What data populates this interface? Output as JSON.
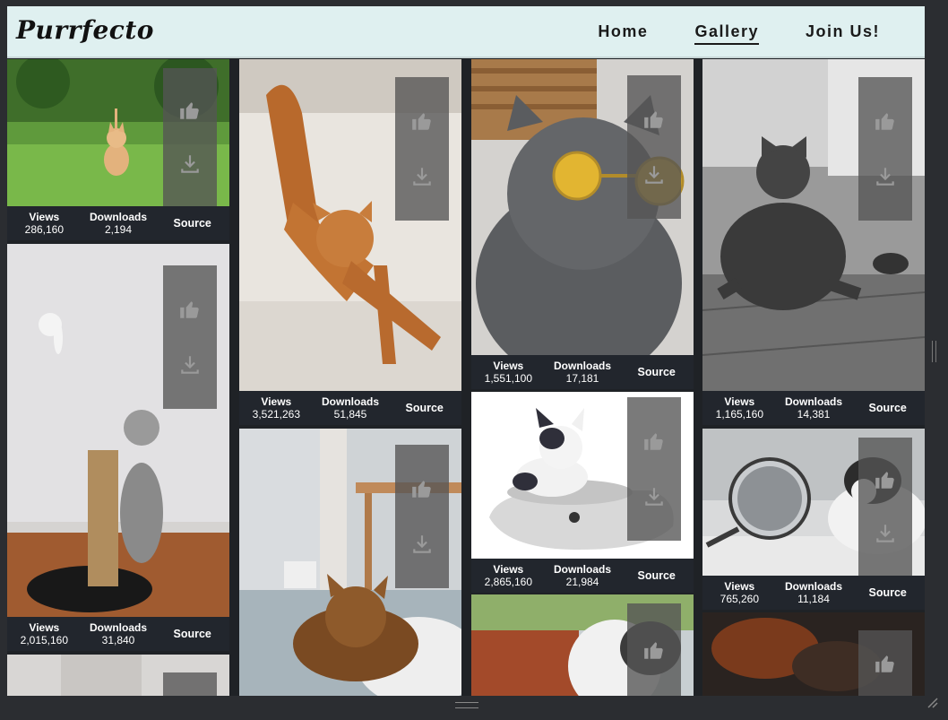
{
  "brand": {
    "name": "Purrfecto"
  },
  "nav": {
    "items": [
      {
        "label": "Home",
        "active": false
      },
      {
        "label": "Gallery",
        "active": true
      },
      {
        "label": "Join Us!",
        "active": false
      }
    ]
  },
  "labels": {
    "views": "Views",
    "downloads": "Downloads",
    "source": "Source"
  },
  "icons": {
    "like": "thumbs-up-icon",
    "download": "download-icon"
  },
  "cards": [
    {
      "views": "286,160",
      "downloads": "2,194"
    },
    {
      "views": "2,015,160",
      "downloads": "31,840"
    },
    {
      "views": "3,521,263",
      "downloads": "51,845"
    },
    {
      "views": "1,551,100",
      "downloads": "17,181"
    },
    {
      "views": "2,865,160",
      "downloads": "21,984"
    },
    {
      "views": "1,165,160",
      "downloads": "14,381"
    },
    {
      "views": "765,260",
      "downloads": "11,184"
    }
  ],
  "colors": {
    "header_bg": "#dff0f0",
    "stats_bg": "#22262d",
    "overlay": "#555555",
    "page_bg": "#1f2226"
  }
}
